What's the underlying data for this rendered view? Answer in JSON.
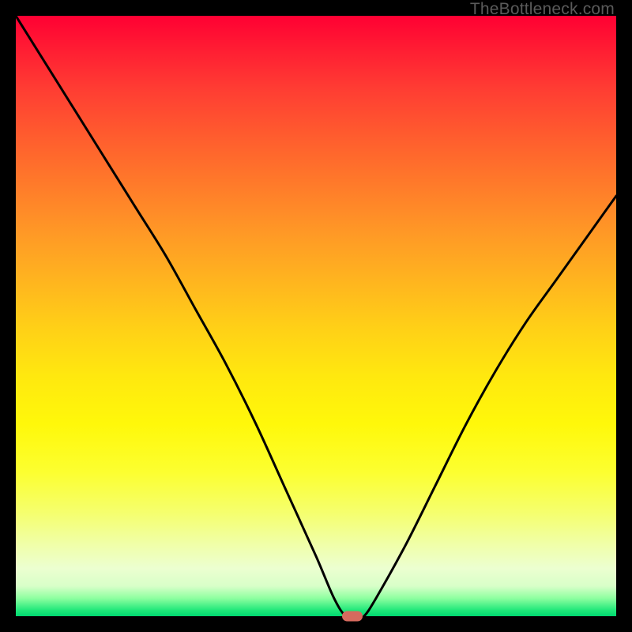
{
  "watermark": "TheBottleneck.com",
  "chart_data": {
    "type": "line",
    "title": "",
    "xlabel": "",
    "ylabel": "",
    "xlim": [
      0,
      100
    ],
    "ylim": [
      0,
      100
    ],
    "x": [
      0,
      5,
      10,
      15,
      20,
      25,
      30,
      35,
      40,
      45,
      50,
      53,
      55,
      57,
      58,
      60,
      65,
      70,
      75,
      80,
      85,
      90,
      95,
      100
    ],
    "values": [
      100,
      92,
      84,
      76,
      68,
      60,
      51,
      42,
      32,
      21,
      10,
      3,
      0,
      0,
      0,
      3,
      12,
      22,
      32,
      41,
      49,
      56,
      63,
      70
    ],
    "minimum_marker": {
      "x": 56,
      "y": 0
    },
    "gradient_stops": [
      {
        "pos": 0,
        "color": "#ff0033"
      },
      {
        "pos": 20,
        "color": "#ff5c2e"
      },
      {
        "pos": 44,
        "color": "#ffb41f"
      },
      {
        "pos": 68,
        "color": "#fff80a"
      },
      {
        "pos": 88,
        "color": "#f0ffa8"
      },
      {
        "pos": 99,
        "color": "#20e87a"
      },
      {
        "pos": 100,
        "color": "#00d870"
      }
    ]
  }
}
